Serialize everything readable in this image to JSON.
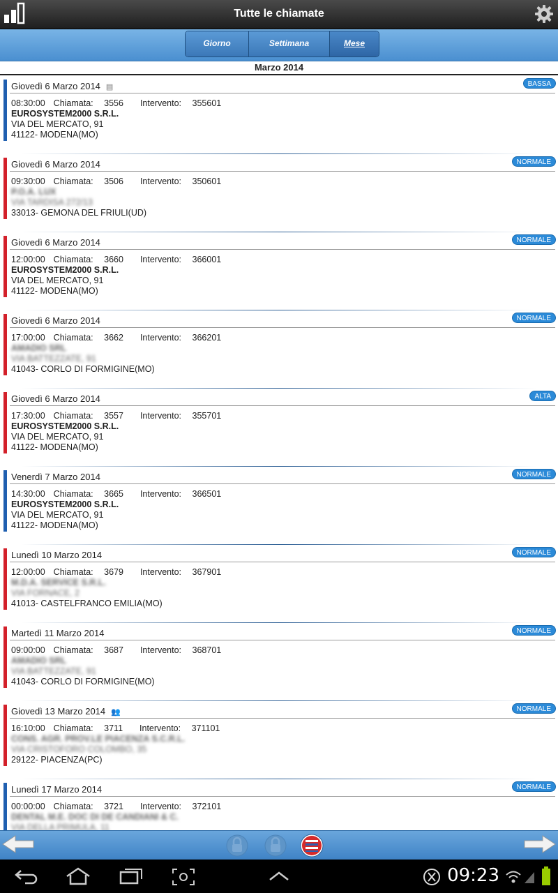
{
  "header": {
    "title": "Tutte le chiamate"
  },
  "tabs": [
    {
      "label": "Giorno",
      "active": false
    },
    {
      "label": "Settimana",
      "active": false
    },
    {
      "label": "Mese",
      "active": true
    }
  ],
  "month_label": "Marzo 2014",
  "labels": {
    "chiamata": "Chiamata:",
    "intervento": "Intervento:"
  },
  "colors": {
    "blue_bar": "#1f5fb0",
    "red_bar": "#d3202a",
    "badge": "#2b8ad8"
  },
  "items": [
    {
      "date": "Giovedì 6 Marzo 2014",
      "note_icon": true,
      "priority": "BASSA",
      "time": "08:30:00",
      "chiamata": "3556",
      "intervento": "355601",
      "company": "EUROSYSTEM2000 S.R.L.",
      "address": "VIA DEL MERCATO, 91",
      "city": "41122- MODENA(MO)",
      "bar": "blue",
      "blurred": false
    },
    {
      "date": "Giovedì 6 Marzo 2014",
      "priority": "NORMALE",
      "time": "09:30:00",
      "chiamata": "3506",
      "intervento": "350601",
      "company": "P.O.A. LUX",
      "address": "VIA TARDISA 272/13",
      "city": "33013- GEMONA DEL FRIULI(UD)",
      "bar": "red",
      "blurred": true
    },
    {
      "date": "Giovedì 6 Marzo 2014",
      "priority": "NORMALE",
      "time": "12:00:00",
      "chiamata": "3660",
      "intervento": "366001",
      "company": "EUROSYSTEM2000 S.R.L.",
      "address": "VIA DEL MERCATO, 91",
      "city": "41122- MODENA(MO)",
      "bar": "red",
      "blurred": false
    },
    {
      "date": "Giovedì 6 Marzo 2014",
      "priority": "NORMALE",
      "time": "17:00:00",
      "chiamata": "3662",
      "intervento": "366201",
      "company": "AMADIO SRL",
      "address": "VIA BATTEZZATE, 91",
      "city": "41043- CORLO DI FORMIGINE(MO)",
      "bar": "red",
      "blurred": true
    },
    {
      "date": "Giovedì 6 Marzo 2014",
      "priority": "ALTA",
      "time": "17:30:00",
      "chiamata": "3557",
      "intervento": "355701",
      "company": "EUROSYSTEM2000 S.R.L.",
      "address": "VIA DEL MERCATO, 91",
      "city": "41122- MODENA(MO)",
      "bar": "red",
      "blurred": false
    },
    {
      "date": "Venerdì 7 Marzo 2014",
      "priority": "NORMALE",
      "time": "14:30:00",
      "chiamata": "3665",
      "intervento": "366501",
      "company": "EUROSYSTEM2000 S.R.L.",
      "address": "VIA DEL MERCATO, 91",
      "city": "41122- MODENA(MO)",
      "bar": "blue",
      "blurred": false
    },
    {
      "date": "Lunedì 10 Marzo 2014",
      "priority": "NORMALE",
      "time": "12:00:00",
      "chiamata": "3679",
      "intervento": "367901",
      "company": "M.D.A. SERVICE S.R.L.",
      "address": "VIA FORNACE, 2",
      "city": "41013- CASTELFRANCO EMILIA(MO)",
      "bar": "red",
      "blurred": true
    },
    {
      "date": "Martedì 11 Marzo 2014",
      "priority": "NORMALE",
      "time": "09:00:00",
      "chiamata": "3687",
      "intervento": "368701",
      "company": "AMADIO SRL",
      "address": "VIA BATTEZZATE, 91",
      "city": "41043- CORLO DI FORMIGINE(MO)",
      "bar": "red",
      "blurred": true
    },
    {
      "date": "Giovedì 13 Marzo 2014",
      "people_icon": true,
      "priority": "NORMALE",
      "time": "16:10:00",
      "chiamata": "3711",
      "intervento": "371101",
      "company": "CONS. AGR. PROV.LE PIACENZA S.C.R.L.",
      "address": "VIA CRISTOFORO COLOMBO, 35",
      "city": "29122- PIACENZA(PC)",
      "bar": "red",
      "blurred": true
    },
    {
      "date": "Lunedì 17 Marzo 2014",
      "priority": "NORMALE",
      "time": "00:00:00",
      "chiamata": "3721",
      "intervento": "372101",
      "company": "DENTAL M.E. DOC DI DE CANDIANI & C.",
      "address": "VIA DELLA PRIMULA, 11",
      "city": "",
      "bar": "blue",
      "blurred": true
    }
  ],
  "status_bar": {
    "time": "09:23"
  }
}
